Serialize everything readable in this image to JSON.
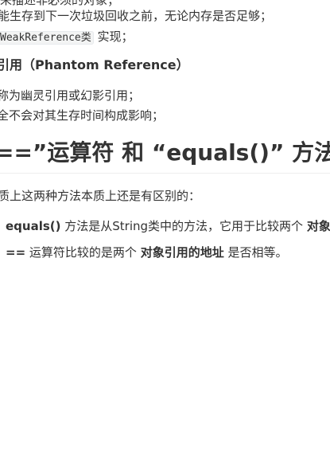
{
  "lines": {
    "l0": "来描述非必须的对象；",
    "l1": "能生存到下一次垃圾回收之前，无论内存是否足够；",
    "l2_code": "WeakReference类",
    "l2_rest": " 实现；",
    "h4": "引用（Phantom Reference）",
    "l4": "称为幽灵引用或幻影引用；",
    "l5": "全不会对其生存时间构成影响；"
  },
  "section": {
    "title": "==”运算符 和 “equals()” 方法",
    "intro": "质上这两种方法本质上还是有区别的：",
    "items": [
      {
        "bold": "equals()",
        "text": " 方法是从String类中的方法，它用于比较两个 ",
        "bold2": "对象"
      },
      {
        "bold": "==",
        "text": " 运算符比较的是两个 ",
        "bold2": "对象引用的地址",
        "tail": " 是否相等。"
      }
    ]
  }
}
